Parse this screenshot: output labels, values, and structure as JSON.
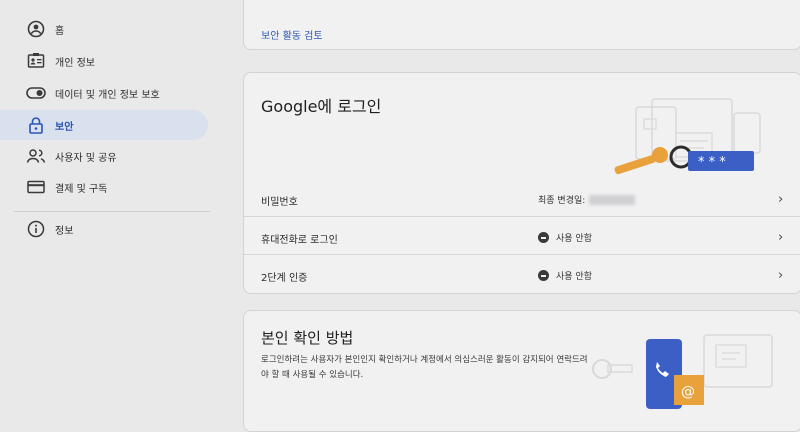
{
  "sidebar": {
    "items": [
      {
        "label": "홈",
        "icon": "home-icon"
      },
      {
        "label": "개인 정보",
        "icon": "id-card-icon"
      },
      {
        "label": "데이터 및 개인 정보 보호",
        "icon": "toggle-icon"
      },
      {
        "label": "보안",
        "icon": "lock-icon",
        "active": true
      },
      {
        "label": "사용자 및 공유",
        "icon": "people-icon"
      },
      {
        "label": "결제 및 구독",
        "icon": "credit-card-icon"
      }
    ],
    "about": {
      "label": "정보",
      "icon": "info-icon"
    }
  },
  "top_card": {
    "link": "보안 활동 검토"
  },
  "signin_card": {
    "title": "Google에 로그인",
    "rows": [
      {
        "label": "비밀번호",
        "value": "최종 변경일:"
      },
      {
        "label": "휴대전화로 로그인",
        "value": "사용 안함"
      },
      {
        "label": "2단계 인증",
        "value": "사용 안함"
      }
    ]
  },
  "verify_card": {
    "title": "본인 확인 방법",
    "description": "로그인하려는 사용자가 본인인지 확인하거나 계정에서 의심스러운 활동이 감지되어 연락드려야 할 때 사용될 수 있습니다."
  },
  "colors": {
    "accent": "#2a55b8",
    "active_bg": "#d9e0ee",
    "page_bg": "#e9e9ea",
    "card_bg": "#f1f1f2"
  }
}
